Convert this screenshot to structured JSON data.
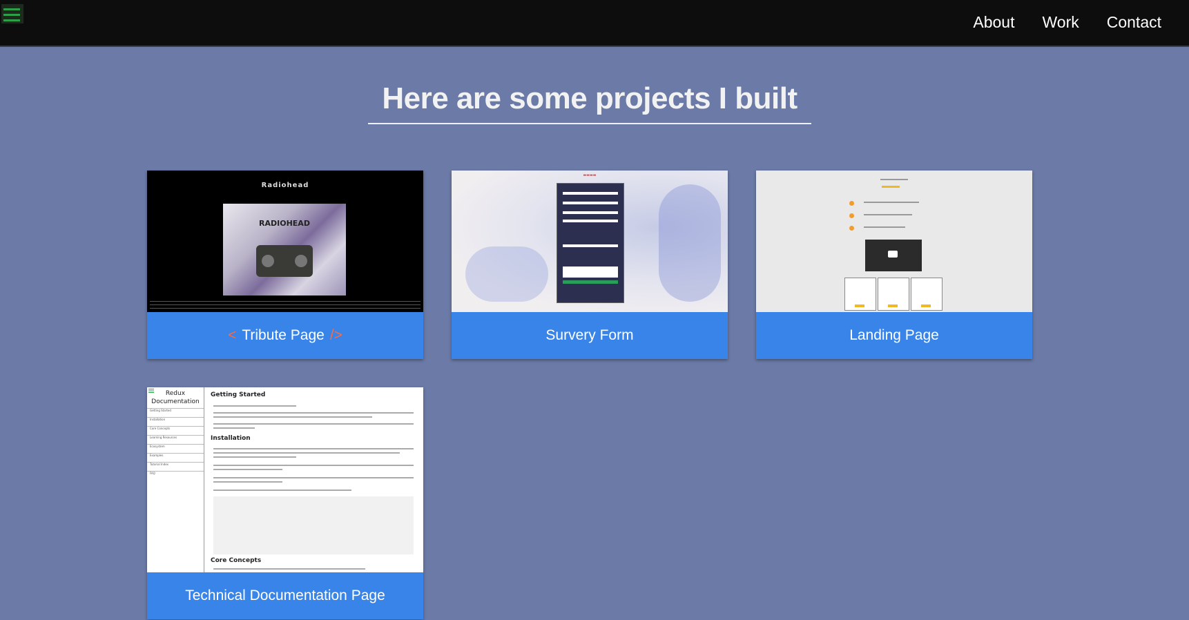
{
  "nav": {
    "links": [
      "About",
      "Work",
      "Contact"
    ]
  },
  "heading": "Here are some projects I built",
  "projects": [
    {
      "label": "Tribute Page",
      "prefix_glyph": "<",
      "suffix_glyph": "/>",
      "thumb": {
        "title": "Radiohead",
        "image_text": "RADIOHEAD"
      }
    },
    {
      "label": "Survery Form"
    },
    {
      "label": "Landing Page"
    },
    {
      "label": "Technical Documentation Page",
      "thumb": {
        "sidebar_title": "Redux Documentation",
        "sidebar_items": [
          "Getting Started",
          "Installation",
          "Core Concepts",
          "Learning Resources",
          "Ecosystem",
          "Examples",
          "Tutorial Index",
          "FAQ"
        ],
        "sections": [
          "Getting Started",
          "Installation",
          "Core Concepts"
        ]
      }
    }
  ],
  "colors": {
    "background": "#6b7aa6",
    "nav": "#0d0d0e",
    "card_label": "#3884e8",
    "accent": "#ff6a3d"
  }
}
